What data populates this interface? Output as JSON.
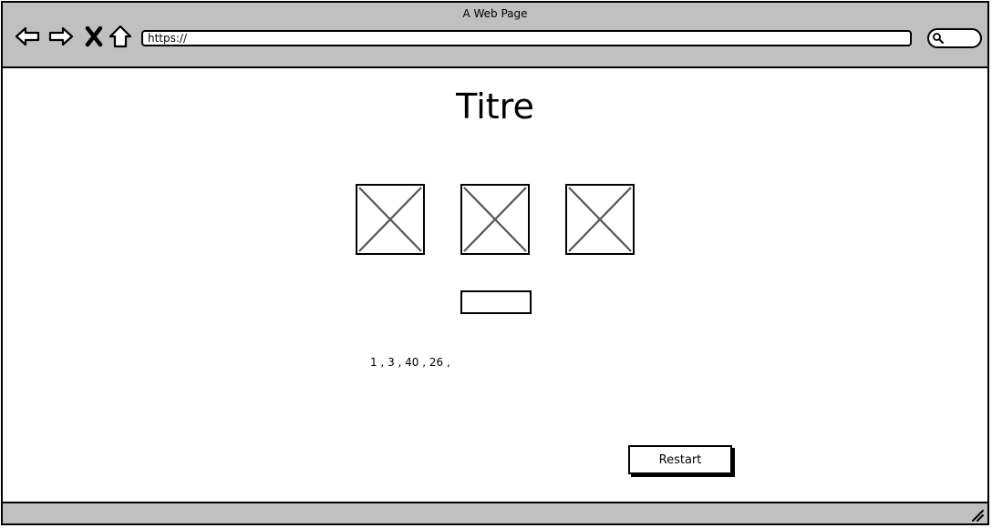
{
  "window": {
    "title": "A Web Page"
  },
  "toolbar": {
    "back_icon": "arrow-left-icon",
    "forward_icon": "arrow-right-icon",
    "stop_icon": "close-icon",
    "home_icon": "home-icon",
    "url": "https://",
    "search_icon": "search-icon"
  },
  "page": {
    "title": "Titre",
    "images": [
      "image-placeholder",
      "image-placeholder",
      "image-placeholder"
    ],
    "answer_value": "",
    "sequence_text": "1 , 3 , 40 , 26 ,",
    "restart_label": "Restart"
  },
  "colors": {
    "chrome": "#c0c0c0",
    "border": "#000000",
    "placeholder_cross": "#555555",
    "background": "#ffffff"
  }
}
